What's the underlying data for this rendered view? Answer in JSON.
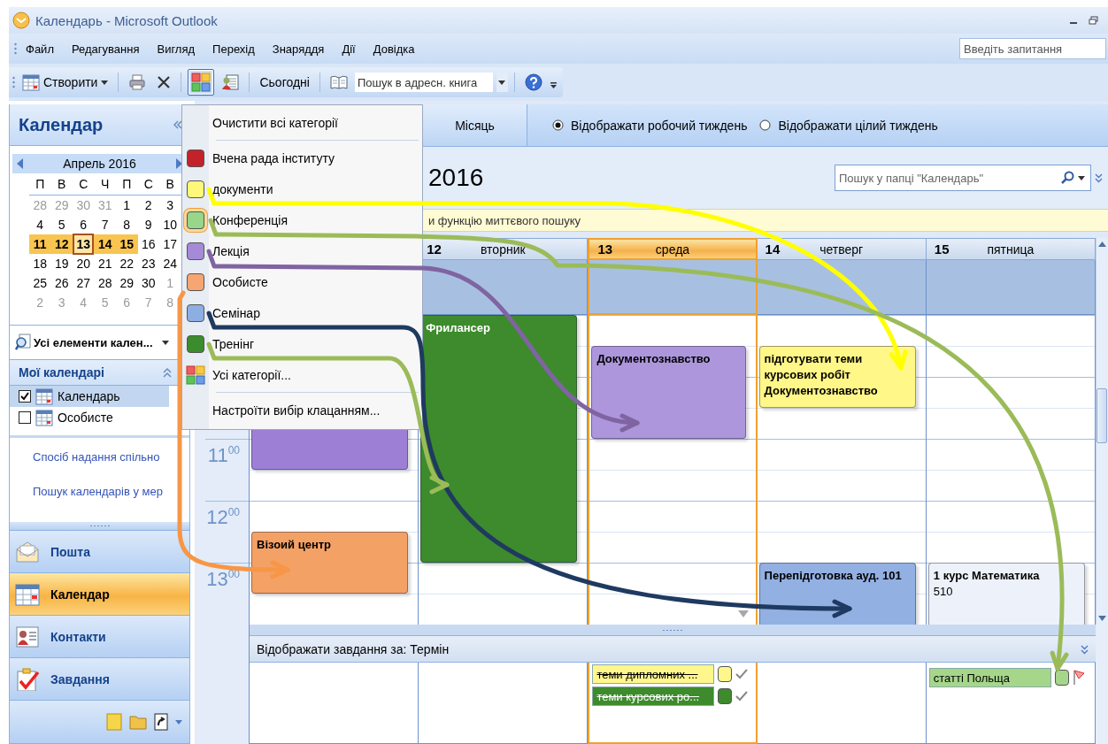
{
  "window": {
    "title": "Календарь - Microsoft Outlook"
  },
  "menu_bar": [
    "Файл",
    "Редагування",
    "Вигляд",
    "Перехід",
    "Знаряддя",
    "Дії",
    "Довідка"
  ],
  "help_search": {
    "placeholder": "Введіть запитання"
  },
  "toolbar": [
    {
      "kind": "new",
      "label": "Створити",
      "pressed": false
    },
    {
      "kind": "print",
      "pressed": false
    },
    {
      "kind": "delete",
      "pressed": false
    },
    {
      "kind": "categorize",
      "pressed": true
    },
    {
      "kind": "address-book",
      "pressed": false
    },
    {
      "kind": "today",
      "label": "Сьогодні",
      "pressed": false
    },
    {
      "kind": "book",
      "pressed": false
    },
    {
      "kind": "address-search",
      "value": "Пошук в адресн. книга"
    },
    {
      "kind": "help",
      "pressed": false
    }
  ],
  "nav_pane": {
    "title": "Календар",
    "month": "Апрель 2016",
    "weekdays": [
      "П",
      "В",
      "С",
      "Ч",
      "П",
      "С",
      "В"
    ],
    "weeks": [
      {
        "days": [
          {
            "t": "28",
            "other": true,
            "range": false,
            "selected": false
          },
          {
            "t": "29",
            "other": true,
            "range": false,
            "selected": false
          },
          {
            "t": "30",
            "other": true,
            "range": false,
            "selected": false
          },
          {
            "t": "31",
            "other": true,
            "range": false,
            "selected": false
          },
          {
            "t": "1",
            "other": false,
            "range": false,
            "selected": false
          },
          {
            "t": "2",
            "other": false,
            "range": false,
            "selected": false
          },
          {
            "t": "3",
            "other": false,
            "range": false,
            "selected": false
          }
        ]
      },
      {
        "days": [
          {
            "t": "4",
            "other": false,
            "range": false,
            "selected": false
          },
          {
            "t": "5",
            "other": false,
            "range": false,
            "selected": false
          },
          {
            "t": "6",
            "other": false,
            "range": false,
            "selected": false
          },
          {
            "t": "7",
            "other": false,
            "range": false,
            "selected": false
          },
          {
            "t": "8",
            "other": false,
            "range": false,
            "selected": false
          },
          {
            "t": "9",
            "other": false,
            "range": false,
            "selected": false
          },
          {
            "t": "10",
            "other": false,
            "range": false,
            "selected": false
          }
        ]
      },
      {
        "days": [
          {
            "t": "11",
            "other": false,
            "range": true,
            "selected": false
          },
          {
            "t": "12",
            "other": false,
            "range": true,
            "selected": false
          },
          {
            "t": "13",
            "other": false,
            "range": true,
            "selected": true
          },
          {
            "t": "14",
            "other": false,
            "range": true,
            "selected": false
          },
          {
            "t": "15",
            "other": false,
            "range": true,
            "selected": false
          },
          {
            "t": "16",
            "other": false,
            "range": false,
            "selected": false
          },
          {
            "t": "17",
            "other": false,
            "range": false,
            "selected": false
          }
        ]
      },
      {
        "days": [
          {
            "t": "18",
            "other": false,
            "range": false,
            "selected": false
          },
          {
            "t": "19",
            "other": false,
            "range": false,
            "selected": false
          },
          {
            "t": "20",
            "other": false,
            "range": false,
            "selected": false
          },
          {
            "t": "21",
            "other": false,
            "range": false,
            "selected": false
          },
          {
            "t": "22",
            "other": false,
            "range": false,
            "selected": false
          },
          {
            "t": "23",
            "other": false,
            "range": false,
            "selected": false
          },
          {
            "t": "24",
            "other": false,
            "range": false,
            "selected": false
          }
        ]
      },
      {
        "days": [
          {
            "t": "25",
            "other": false,
            "range": false,
            "selected": false
          },
          {
            "t": "26",
            "other": false,
            "range": false,
            "selected": false
          },
          {
            "t": "27",
            "other": false,
            "range": false,
            "selected": false
          },
          {
            "t": "28",
            "other": false,
            "range": false,
            "selected": false
          },
          {
            "t": "29",
            "other": false,
            "range": false,
            "selected": false
          },
          {
            "t": "30",
            "other": false,
            "range": false,
            "selected": false
          },
          {
            "t": "1",
            "other": true,
            "range": false,
            "selected": false
          }
        ]
      },
      {
        "days": [
          {
            "t": "2",
            "other": true,
            "range": false,
            "selected": false
          },
          {
            "t": "3",
            "other": true,
            "range": false,
            "selected": false
          },
          {
            "t": "4",
            "other": true,
            "range": false,
            "selected": false
          },
          {
            "t": "5",
            "other": true,
            "range": false,
            "selected": false
          },
          {
            "t": "6",
            "other": true,
            "range": false,
            "selected": false
          },
          {
            "t": "7",
            "other": true,
            "range": false,
            "selected": false
          },
          {
            "t": "8",
            "other": true,
            "range": false,
            "selected": false
          }
        ]
      }
    ],
    "view_filter": "Усі елементи кален...",
    "my_calendars": {
      "title": "Мої календарі",
      "items": [
        {
          "label": "Календарь",
          "checked": true,
          "selected": true
        },
        {
          "label": "Особисте",
          "checked": false,
          "selected": false
        }
      ]
    },
    "links": [
      "Спосіб надання спільно",
      "Пошук календарів у мер"
    ],
    "buttons": [
      {
        "label": "Пошта",
        "selected": false
      },
      {
        "label": "Календар",
        "selected": true
      },
      {
        "label": "Контакти",
        "selected": false
      },
      {
        "label": "Завдання",
        "selected": false
      }
    ]
  },
  "calendar": {
    "view_tabs": [
      {
        "label": "Місяць",
        "selected": false
      }
    ],
    "view_options": [
      {
        "label": "Відображати робочий тиждень",
        "selected": true
      },
      {
        "label": "Відображати цілий тиждень",
        "selected": false
      }
    ],
    "date_range": "2016",
    "folder_search": {
      "placeholder": "Пошук у папці \"Календарь\""
    },
    "info_bar": "и функцію миттєвого пошуку",
    "time_labels": [
      "11$^{00}$",
      "12$^{00}$",
      "13$^{00}$"
    ],
    "days": [
      {
        "more": false,
        "events": [
          {
            "color": "#9d80d6"
          },
          {
            "title": "Візоий центр",
            "color": "#f4a166"
          }
        ]
      },
      {
        "number": "12",
        "name": "вторник",
        "today": false,
        "more": false,
        "events": [
          {
            "title": "Фрилансер",
            "color": "#3d8b2c"
          }
        ]
      },
      {
        "number": "13",
        "name": "среда",
        "today": true,
        "more": true,
        "events": [
          {
            "title": "Документознавство",
            "color": "#ad96dc"
          }
        ],
        "tasks": [
          {
            "title": "теми дипломних ...",
            "color": "#fff78c",
            "done": true
          },
          {
            "title": "теми курсових ро...",
            "color": "#3d8b2c",
            "done": true
          }
        ]
      },
      {
        "number": "14",
        "name": "четверг",
        "today": false,
        "more": false,
        "events": [
          {
            "title": "підготувати теми курсових робіт Документознавство",
            "color": "#fff787"
          },
          {
            "title": "Перепідготовка ауд. 101",
            "color": "#93b0e3"
          }
        ]
      },
      {
        "number": "15",
        "name": "пятница",
        "today": false,
        "more": false,
        "events": [
          {
            "title": "1 курс Математика",
            "subtitle": "510",
            "color": "#edf2fa"
          }
        ],
        "tasks": [
          {
            "title": "статті Польща",
            "color": "#a6d68a",
            "done": false
          }
        ]
      }
    ],
    "tasks_header": "Відображати завдання за: Термін"
  },
  "category_menu": {
    "items": [
      {
        "kind": "action",
        "label": "Очистити всі категорії"
      },
      {
        "kind": "separator"
      },
      {
        "kind": "category",
        "label": "Вчена рада інституту",
        "color": "#c3222a",
        "checked": false
      },
      {
        "kind": "category",
        "label": "документи",
        "color": "#fff77a",
        "checked": false
      },
      {
        "kind": "category",
        "label": "Конференція",
        "color": "#98d68a",
        "checked": true
      },
      {
        "kind": "category",
        "label": "Лекція",
        "color": "#a58ad8",
        "checked": false
      },
      {
        "kind": "category",
        "label": "Особисте",
        "color": "#f7a673",
        "checked": false
      },
      {
        "kind": "category",
        "label": "Семінар",
        "color": "#8daee3",
        "checked": false
      },
      {
        "kind": "category",
        "label": "Тренінг",
        "color": "#3b8c2c",
        "checked": false
      },
      {
        "kind": "all",
        "label": "Усі категорії..."
      },
      {
        "kind": "separator"
      },
      {
        "kind": "action",
        "label": "Настроїти вибір клацанням..."
      }
    ]
  }
}
